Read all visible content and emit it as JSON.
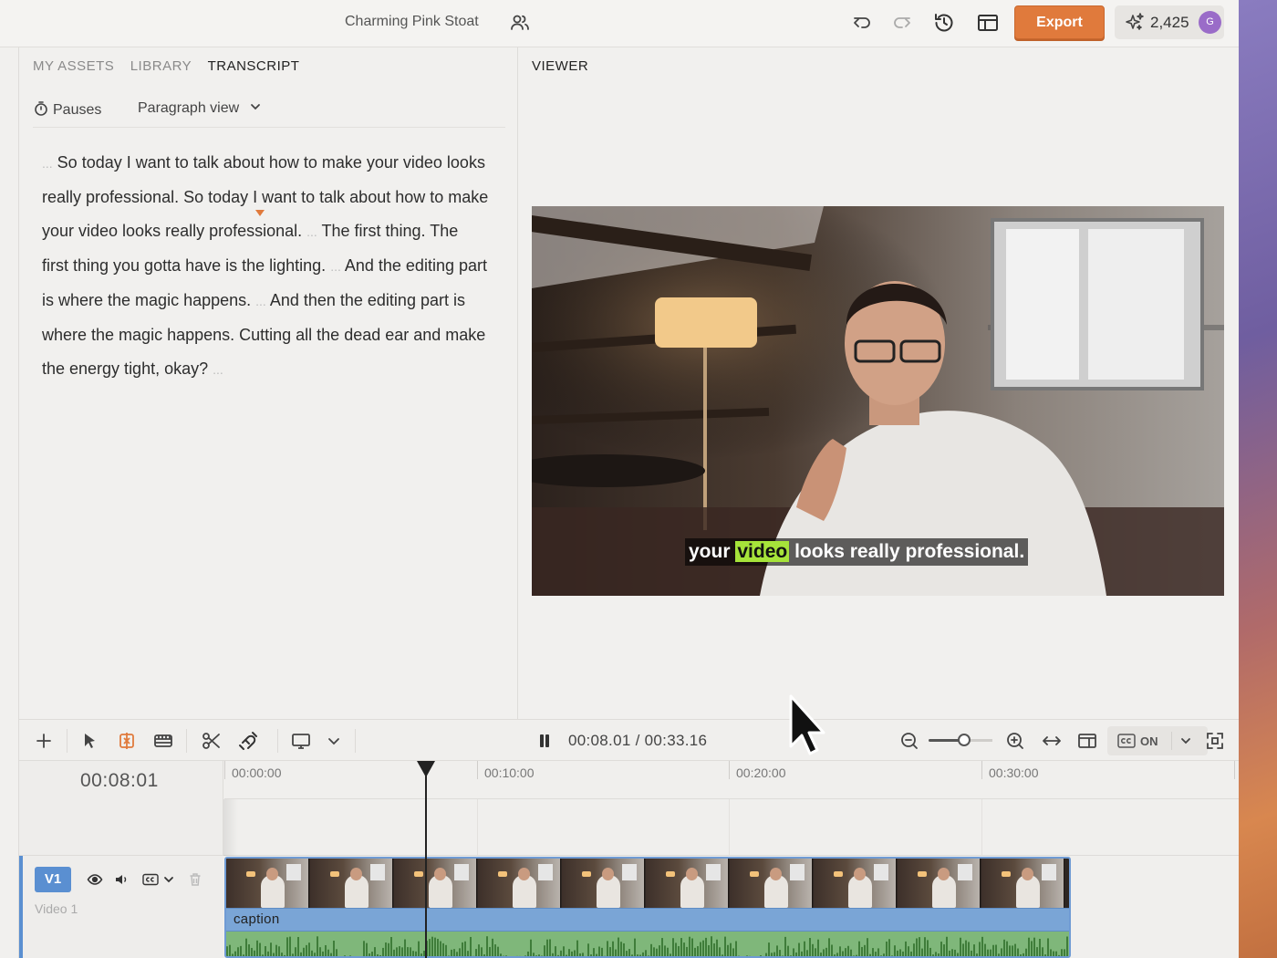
{
  "header": {
    "project_title": "Charming Pink Stoat",
    "export_label": "Export",
    "credits": "2,425",
    "avatar_initial": "G",
    "accent_color": "#e07a3c"
  },
  "left_panel": {
    "tabs": [
      {
        "label": "MY ASSETS",
        "active": false
      },
      {
        "label": "LIBRARY",
        "active": false
      },
      {
        "label": "TRANSCRIPT",
        "active": true
      }
    ],
    "pauses_label": "Pauses",
    "view_mode_label": "Paragraph view",
    "transcript": [
      {
        "pause": "..."
      },
      {
        "text": " So today I want to talk about how to make your video looks really professional. So today I want to talk about how to make your video looks really professional. "
      },
      {
        "pause": "..."
      },
      {
        "text": " The first thing. The first thing you gotta have is the lighting. "
      },
      {
        "pause": "..."
      },
      {
        "text": " And the editing part is where the magic happens. "
      },
      {
        "pause": "..."
      },
      {
        "text": " And then the editing part is where the magic happens. Cutting all the dead ear and make the energy tight, okay? "
      },
      {
        "pause": "..."
      }
    ]
  },
  "viewer": {
    "title": "VIEWER",
    "caption_before": "your",
    "caption_highlight": "video",
    "caption_after": "looks really professional.",
    "highlight_color": "#a6e33a"
  },
  "timeline_toolbar": {
    "current_time": "00:08.01",
    "separator": "/",
    "total_time": "00:33.16",
    "zoom_level": 0.57,
    "cc_label": "ON"
  },
  "timeline": {
    "current_timecode": "00:08:01",
    "ruler_labels": [
      "00:00:00",
      "00:10:00",
      "00:20:00",
      "00:30:00"
    ],
    "track": {
      "badge": "V1",
      "name": "Video 1",
      "caption_label": "caption",
      "track_color": "#5a8fd1",
      "audio_color": "#7fb77a"
    }
  }
}
